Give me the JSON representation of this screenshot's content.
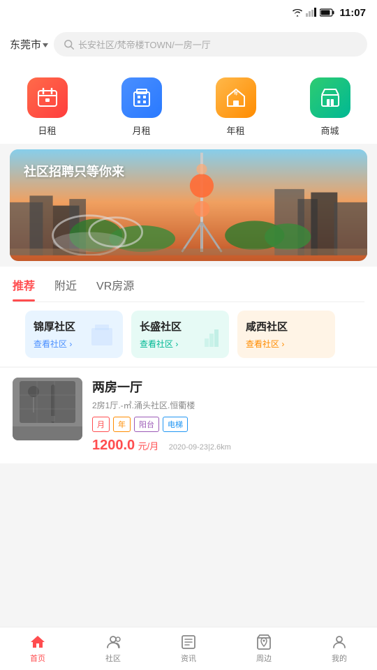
{
  "status": {
    "time": "11:07"
  },
  "header": {
    "city": "东莞市",
    "search_placeholder": "长安社区/梵帝楼TOWN/一房一厅"
  },
  "quick_menu": {
    "items": [
      {
        "id": "daily",
        "label": "日租",
        "color": "red"
      },
      {
        "id": "monthly",
        "label": "月租",
        "color": "blue"
      },
      {
        "id": "yearly",
        "label": "年租",
        "color": "orange"
      },
      {
        "id": "mall",
        "label": "商城",
        "color": "green"
      }
    ]
  },
  "banner": {
    "text": "社区招聘只等你来"
  },
  "tabs": {
    "items": [
      {
        "id": "recommend",
        "label": "推荐",
        "active": true
      },
      {
        "id": "nearby",
        "label": "附近",
        "active": false
      },
      {
        "id": "vr",
        "label": "VR房源",
        "active": false
      }
    ]
  },
  "communities": [
    {
      "id": "jinhou",
      "name": "锦厚社区",
      "link": "查看社区 ›",
      "style": "light-blue",
      "link_color": "blue"
    },
    {
      "id": "changsheng",
      "name": "长盛社区",
      "link": "查看社区 ›",
      "style": "light-teal",
      "link_color": "teal"
    },
    {
      "id": "xianxi",
      "name": "咸西社区",
      "link": "查看社区 ›",
      "style": "light-orange",
      "link_color": "orange"
    }
  ],
  "listing": {
    "title": "两房一厅",
    "subtitle": "2房1厅.-㎡.涌头社区.恒衢楼",
    "tags": [
      {
        "id": "month",
        "label": "月",
        "style": "month"
      },
      {
        "id": "year",
        "label": "年",
        "style": "year"
      },
      {
        "id": "balcony",
        "label": "阳台",
        "style": "balcony"
      },
      {
        "id": "elevator",
        "label": "电梯",
        "style": "elevator"
      }
    ],
    "price": "1200.0",
    "price_unit": "元/月",
    "meta": "2020-09-23|2.6km"
  },
  "bottom_nav": {
    "items": [
      {
        "id": "home",
        "label": "首页",
        "active": true
      },
      {
        "id": "community",
        "label": "社区",
        "active": false
      },
      {
        "id": "news",
        "label": "资讯",
        "active": false
      },
      {
        "id": "nearby",
        "label": "周边",
        "active": false
      },
      {
        "id": "mine",
        "label": "我的",
        "active": false
      }
    ]
  }
}
